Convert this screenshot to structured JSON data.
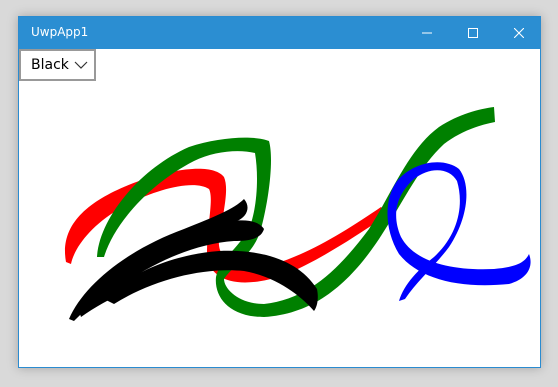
{
  "window": {
    "title": "UwpApp1",
    "accent_color": "#2b8ed2"
  },
  "caption_buttons": {
    "minimize_icon": "minimize-icon",
    "maximize_icon": "maximize-icon",
    "close_icon": "close-icon"
  },
  "color_selector": {
    "selected": "Black",
    "icon": "chevron-down-icon"
  },
  "ink_strokes": [
    {
      "name": "red-ink-stroke",
      "color": "#ff0000"
    },
    {
      "name": "green-ink-stroke",
      "color": "#008000"
    },
    {
      "name": "blue-ink-stroke",
      "color": "#0000ff"
    },
    {
      "name": "black-ink-stroke",
      "color": "#000000"
    }
  ]
}
